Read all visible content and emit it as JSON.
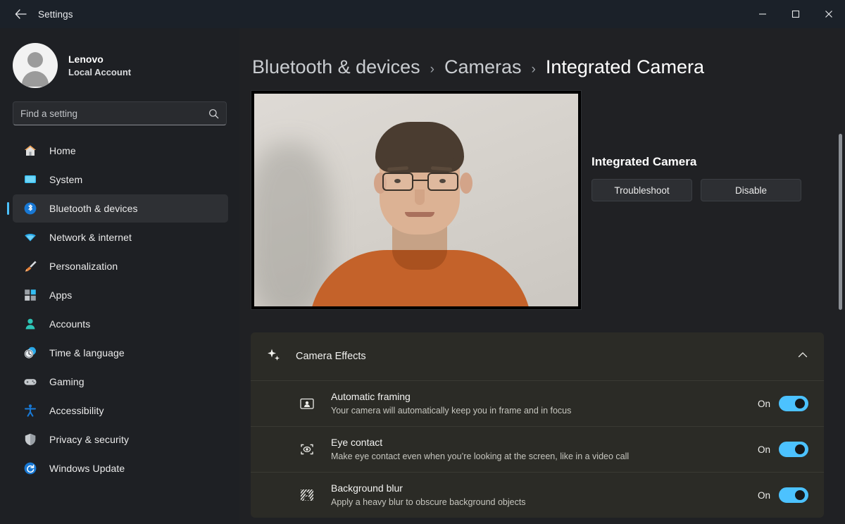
{
  "window": {
    "title": "Settings",
    "back_icon": "back-arrow-icon",
    "minimize_label": "—",
    "maximize_label": "☐",
    "close_label": "✕"
  },
  "sidebar": {
    "account": {
      "name": "Lenovo",
      "type": "Local Account",
      "avatar_icon": "user-avatar-icon"
    },
    "search": {
      "placeholder": "Find a setting",
      "value": "",
      "icon": "search-icon"
    },
    "items": [
      {
        "label": "Home",
        "icon": "home-icon",
        "selected": false
      },
      {
        "label": "System",
        "icon": "system-icon",
        "selected": false
      },
      {
        "label": "Bluetooth & devices",
        "icon": "bluetooth-icon",
        "selected": true
      },
      {
        "label": "Network & internet",
        "icon": "wifi-icon",
        "selected": false
      },
      {
        "label": "Personalization",
        "icon": "brush-icon",
        "selected": false
      },
      {
        "label": "Apps",
        "icon": "apps-icon",
        "selected": false
      },
      {
        "label": "Accounts",
        "icon": "accounts-icon",
        "selected": false
      },
      {
        "label": "Time & language",
        "icon": "clock-icon",
        "selected": false
      },
      {
        "label": "Gaming",
        "icon": "gamepad-icon",
        "selected": false
      },
      {
        "label": "Accessibility",
        "icon": "accessibility-icon",
        "selected": false
      },
      {
        "label": "Privacy & security",
        "icon": "shield-icon",
        "selected": false
      },
      {
        "label": "Windows Update",
        "icon": "update-icon",
        "selected": false
      }
    ]
  },
  "main": {
    "breadcrumb": [
      {
        "label": "Bluetooth & devices",
        "current": false
      },
      {
        "label": "Cameras",
        "current": false
      },
      {
        "label": "Integrated Camera",
        "current": true
      }
    ],
    "breadcrumb_separator": "›",
    "camera_preview": {
      "name": "camera-preview-video",
      "alt": "Live camera preview"
    },
    "device": {
      "name": "Integrated Camera",
      "troubleshoot_label": "Troubleshoot",
      "disable_label": "Disable"
    },
    "effects": {
      "title": "Camera Effects",
      "sparkle_icon": "sparkle-icon",
      "collapse_icon": "chevron-up-icon",
      "expanded": true,
      "rows": [
        {
          "label": "Automatic framing",
          "description": "Your camera will automatically keep you in frame and in focus",
          "icon": "automatic-framing-icon",
          "state_label": "On",
          "on": true
        },
        {
          "label": "Eye contact",
          "description": "Make eye contact even when you’re looking at the screen, like in a video call",
          "icon": "eye-contact-icon",
          "state_label": "On",
          "on": true
        },
        {
          "label": "Background blur",
          "description": "Apply a heavy blur to obscure background objects",
          "icon": "background-blur-icon",
          "state_label": "On",
          "on": true
        }
      ]
    }
  },
  "colors": {
    "accent": "#4cc2ff",
    "window_bg": "#1e2024",
    "content_bg": "#202124",
    "card_bg": "#2b2b26",
    "titlebar_bg": "#1b2129"
  }
}
